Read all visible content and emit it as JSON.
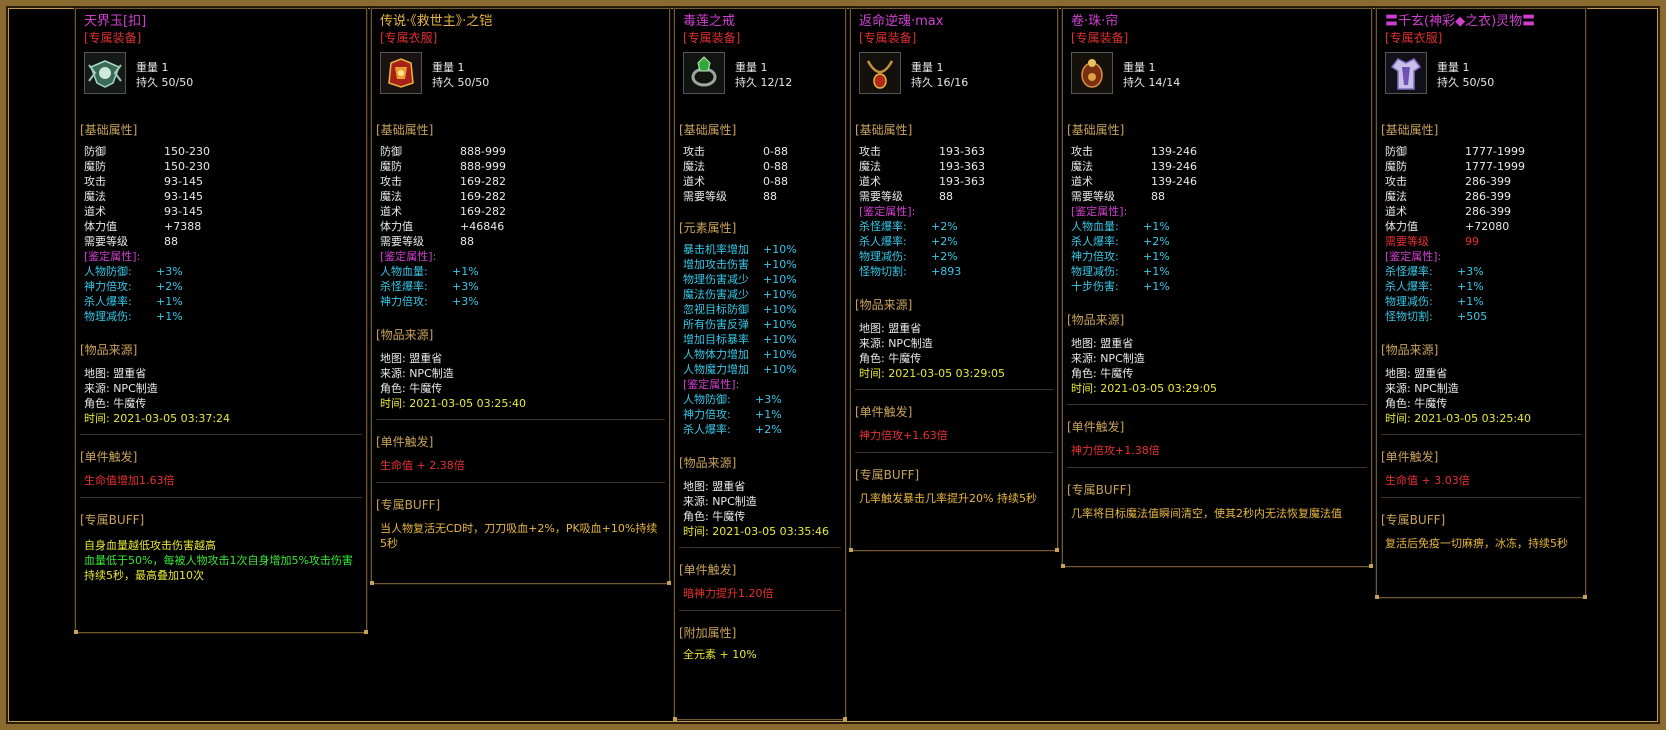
{
  "items": [
    {
      "title": "天界玉[扣]",
      "title_color": "#d040d0",
      "tag": "[专属装备]",
      "weight": "重量 1",
      "durability": "持久 50/50",
      "base_header": "[基础属性]",
      "base": [
        [
          "防御",
          "150-230"
        ],
        [
          "魔防",
          "150-230"
        ],
        [
          "攻击",
          "93-145"
        ],
        [
          "魔法",
          "93-145"
        ],
        [
          "道术",
          "93-145"
        ],
        [
          "体力值",
          "+7388"
        ],
        [
          "需要等级",
          "88"
        ]
      ],
      "appraise_header": "[鉴定属性]:",
      "appraise": [
        [
          "人物防御:",
          "+3%"
        ],
        [
          "神力倍攻:",
          "+2%"
        ],
        [
          "杀人爆率:",
          "+1%"
        ],
        [
          "物理减伤:",
          "+1%"
        ]
      ],
      "source_header": "[物品来源]",
      "source": [
        "地图: 盟重省",
        "来源: NPC制造",
        "角色: 牛魔传"
      ],
      "time": "时间: 2021-03-05 03:37:24",
      "trigger_header": "[单件触发]",
      "trigger": "生命值增加1.63倍",
      "buff_header": "[专属BUFF]",
      "buff1": "自身血量越低攻击伤害越高",
      "buff2": "血量低于50%，每被人物攻击1次自身增加5%攻击伤害",
      "buff3": "持续5秒，最高叠加10次"
    },
    {
      "title": "传说·《救世主》·之铠",
      "title_color": "#e8b840",
      "tag": "[专属衣服]",
      "weight": "重量 1",
      "durability": "持久 50/50",
      "base_header": "[基础属性]",
      "base": [
        [
          "防御",
          "888-999"
        ],
        [
          "魔防",
          "888-999"
        ],
        [
          "攻击",
          "169-282"
        ],
        [
          "魔法",
          "169-282"
        ],
        [
          "道术",
          "169-282"
        ],
        [
          "体力值",
          "+46846"
        ],
        [
          "需要等级",
          "88"
        ]
      ],
      "appraise_header": "[鉴定属性]:",
      "appraise": [
        [
          "人物血量:",
          "+1%"
        ],
        [
          "杀怪爆率:",
          "+3%"
        ],
        [
          "神力倍攻:",
          "+3%"
        ]
      ],
      "source_header": "[物品来源]",
      "source": [
        "地图: 盟重省",
        "来源: NPC制造",
        "角色: 牛魔传"
      ],
      "time": "时间: 2021-03-05 03:25:40",
      "trigger_header": "[单件触发]",
      "trigger": "生命值 + 2.38倍",
      "buff_header": "[专属BUFF]",
      "buff1": "当人物复活无CD时，刀刀吸血+2%，PK吸血+10%持续5秒"
    },
    {
      "title": "毒莲之戒",
      "title_color": "#d040d0",
      "tag": "[专属装备]",
      "weight": "重量 1",
      "durability": "持久 12/12",
      "base_header": "[基础属性]",
      "base": [
        [
          "攻击",
          "0-88"
        ],
        [
          "魔法",
          "0-88"
        ],
        [
          "道术",
          "0-88"
        ],
        [
          "需要等级",
          "88"
        ]
      ],
      "element_header": "[元素属性]",
      "elements": [
        [
          "暴击机率增加",
          "+10%"
        ],
        [
          "增加攻击伤害",
          "+10%"
        ],
        [
          "物理伤害减少",
          "+10%"
        ],
        [
          "魔法伤害减少",
          "+10%"
        ],
        [
          "忽视目标防御",
          "+10%"
        ],
        [
          "所有伤害反弹",
          "+10%"
        ],
        [
          "增加目标暴率",
          "+10%"
        ],
        [
          "人物体力增加",
          "+10%"
        ],
        [
          "人物魔力增加",
          "+10%"
        ]
      ],
      "appraise_header": "[鉴定属性]:",
      "appraise": [
        [
          "人物防御:",
          "+3%"
        ],
        [
          "神力倍攻:",
          "+1%"
        ],
        [
          "杀人爆率:",
          "+2%"
        ]
      ],
      "source_header": "[物品来源]",
      "source": [
        "地图: 盟重省",
        "来源: NPC制造",
        "角色: 牛魔传"
      ],
      "time": "时间: 2021-03-05 03:35:46",
      "trigger_header": "[单件触发]",
      "trigger": "暗神力提升1.20倍",
      "extra_header": "[附加属性]",
      "extra": "全元素 + 10%"
    },
    {
      "title": "返命逆魂·max",
      "title_color": "#d040d0",
      "tag": "[专属装备]",
      "weight": "重量 1",
      "durability": "持久 16/16",
      "base_header": "[基础属性]",
      "base": [
        [
          "攻击",
          "193-363"
        ],
        [
          "魔法",
          "193-363"
        ],
        [
          "道术",
          "193-363"
        ],
        [
          "需要等级",
          "88"
        ]
      ],
      "appraise_header": "[鉴定属性]:",
      "appraise": [
        [
          "杀怪爆率:",
          "+2%"
        ],
        [
          "杀人爆率:",
          "+2%"
        ],
        [
          "物理减伤:",
          "+2%"
        ],
        [
          "怪物切割:",
          "+893"
        ]
      ],
      "source_header": "[物品来源]",
      "source": [
        "地图: 盟重省",
        "来源: NPC制造",
        "角色: 牛魔传"
      ],
      "time": "时间: 2021-03-05 03:29:05",
      "trigger_header": "[单件触发]",
      "trigger": "神力倍攻+1.63倍",
      "buff_header": "[专属BUFF]",
      "buff1": "几率触发暴击几率提升20% 持续5秒"
    },
    {
      "title": "卷·珠·帘",
      "title_color": "#d040d0",
      "tag": "[专属装备]",
      "weight": "重量 1",
      "durability": "持久 14/14",
      "base_header": "[基础属性]",
      "base": [
        [
          "攻击",
          "139-246"
        ],
        [
          "魔法",
          "139-246"
        ],
        [
          "道术",
          "139-246"
        ],
        [
          "需要等级",
          "88"
        ]
      ],
      "appraise_header": "[鉴定属性]:",
      "appraise": [
        [
          "人物血量:",
          "+1%"
        ],
        [
          "杀人爆率:",
          "+2%"
        ],
        [
          "神力倍攻:",
          "+1%"
        ],
        [
          "物理减伤:",
          "+1%"
        ],
        [
          "十步伤害:",
          "+1%"
        ]
      ],
      "source_header": "[物品来源]",
      "source": [
        "地图: 盟重省",
        "来源: NPC制造",
        "角色: 牛魔传"
      ],
      "time": "时间: 2021-03-05 03:29:05",
      "trigger_header": "[单件触发]",
      "trigger": "神力倍攻+1.38倍",
      "buff_header": "[专属BUFF]",
      "buff1": "几率将目标魔法值瞬间清空，使其2秒内无法恢复魔法值"
    },
    {
      "title": "〓千玄(神彩◆之衣)灵物〓",
      "title_color": "#d040d0",
      "tag": "[专属衣服]",
      "weight": "重量 1",
      "durability": "持久 50/50",
      "base_header": "[基础属性]",
      "base": [
        [
          "防御",
          "1777-1999"
        ],
        [
          "魔防",
          "1777-1999"
        ],
        [
          "攻击",
          "286-399"
        ],
        [
          "魔法",
          "286-399"
        ],
        [
          "道术",
          "286-399"
        ],
        [
          "体力值",
          "+72080"
        ]
      ],
      "level_req": [
        "需要等级",
        "99"
      ],
      "appraise_header": "[鉴定属性]:",
      "appraise": [
        [
          "杀怪爆率:",
          "+3%"
        ],
        [
          "杀人爆率:",
          "+1%"
        ],
        [
          "物理减伤:",
          "+1%"
        ],
        [
          "怪物切割:",
          "+505"
        ]
      ],
      "source_header": "[物品来源]",
      "source": [
        "地图: 盟重省",
        "来源: NPC制造",
        "角色: 牛魔传"
      ],
      "time": "时间: 2021-03-05 03:25:40",
      "trigger_header": "[单件触发]",
      "trigger": "生命值 + 3.03倍",
      "buff_header": "[专属BUFF]",
      "buff1": "复活后免疫一切麻痹，冰冻，持续5秒"
    }
  ]
}
